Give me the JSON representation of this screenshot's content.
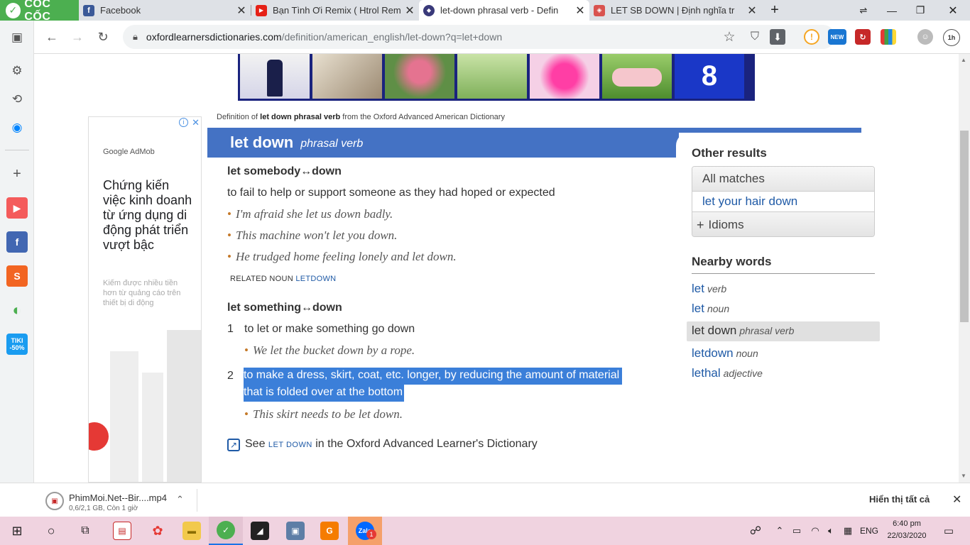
{
  "browser": {
    "brand": "CỐC CỐC",
    "tabs": [
      {
        "title": "Facebook",
        "favicon": "f"
      },
      {
        "title": "Bạn Tình Ơi Remix ( Htrol Rem",
        "favicon": "▶"
      },
      {
        "title": "let-down phrasal verb - Defin",
        "favicon": "◆"
      },
      {
        "title": "LET SB DOWN | Định nghĩa tr",
        "favicon": "◈"
      }
    ],
    "url_host": "oxfordlearnersdictionaries.com",
    "url_path": "/definition/american_english/let-down?q=let+down",
    "ext_new": "NEW",
    "time_badge": "1h"
  },
  "sidebar": {
    "tiki": "TIKI",
    "tiki_discount": "-50%"
  },
  "admob": {
    "brand": "Google AdMob",
    "headline": "Chứng kiến việc kinh doanh từ ứng dụng di động phát triển vượt bậc",
    "subtext": "Kiếm được nhiều tiền hơn từ quảng cáo trên thiết bị di động"
  },
  "entry": {
    "source_prefix": "Definition of ",
    "source_bold": "let down phrasal verb",
    "source_suffix": " from the Oxford Advanced American Dictionary",
    "headword": "let down",
    "pos": "phrasal verb",
    "sense1": {
      "phrase": "let somebody↔down",
      "definition": "to fail to help or support someone as they had hoped or expected",
      "examples": [
        "I'm afraid she let us down badly.",
        "This machine won't let you down.",
        "He trudged home feeling lonely and let down."
      ],
      "related_label": "RELATED NOUN",
      "related_word": "LETDOWN"
    },
    "sense2": {
      "phrase": "let something↔down",
      "num1": "1",
      "def1": "to let or make something go down",
      "ex1": "We let the bucket down by a rope.",
      "num2": "2",
      "def2_line1": "to make a dress, skirt, coat, etc. longer, by reducing the amount of material",
      "def2_line2": "that is folded over at the bottom",
      "ex2": "This skirt needs to be let down."
    },
    "see_prefix": "See ",
    "see_link": "LET DOWN",
    "see_suffix": " in the Oxford Advanced Learner's Dictionary"
  },
  "right": {
    "other_results": "Other results",
    "all_matches": "All matches",
    "match1": "let your hair down",
    "idioms": "Idioms",
    "nearby_title": "Nearby words",
    "nearby": [
      {
        "word": "let",
        "pos": "verb"
      },
      {
        "word": "let",
        "pos": "noun"
      },
      {
        "word": "let down",
        "pos": "phrasal verb"
      },
      {
        "word": "letdown",
        "pos": "noun"
      },
      {
        "word": "lethal",
        "pos": "adjective"
      }
    ]
  },
  "downloads": {
    "filename": "PhimMoi.Net--Bir....mp4",
    "progress": "0,6/2,1 GB, Còn 1 giờ",
    "show_all": "Hiển thị tất cả"
  },
  "taskbar": {
    "lang": "ENG",
    "time": "6:40 pm",
    "date": "22/03/2020",
    "zalo_badge": "1"
  }
}
